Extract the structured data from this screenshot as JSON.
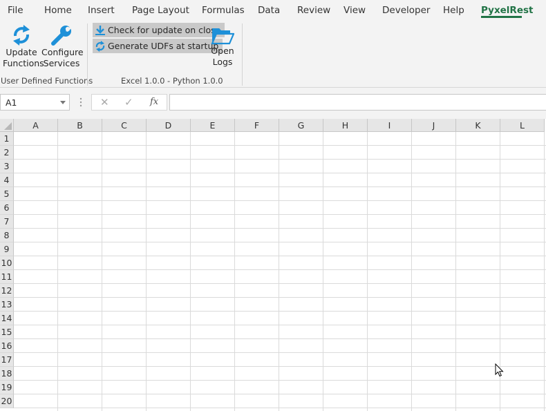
{
  "tabs": [
    "File",
    "Home",
    "Insert",
    "Page Layout",
    "Formulas",
    "Data",
    "Review",
    "View",
    "Developer",
    "Help",
    "PyxelRest"
  ],
  "active_tab": "PyxelRest",
  "ribbon": {
    "update_functions": {
      "line1": "Update",
      "line2": "Functions",
      "icon": "refresh-arrows-icon"
    },
    "configure_services": {
      "line1": "Configure",
      "line2": "Services",
      "icon": "wrench-icon"
    },
    "group1_label": "User Defined Functions",
    "check_update": {
      "label": "Check for update on close",
      "icon": "download-arrow-icon"
    },
    "generate_udfs": {
      "label": "Generate UDFs at startup",
      "icon": "refresh-arrows-icon"
    },
    "open_logs": {
      "line1": "Open",
      "line2": "Logs",
      "icon": "folder-open-icon"
    },
    "group2_label": "Excel 1.0.0 - Python 1.0.0"
  },
  "formula_bar": {
    "name_box": "A1",
    "cancel_symbol": "✕",
    "enter_symbol": "✓",
    "fx_symbol": "fx",
    "formula": ""
  },
  "grid": {
    "columns": [
      "A",
      "B",
      "C",
      "D",
      "E",
      "F",
      "G",
      "H",
      "I",
      "J",
      "K",
      "L"
    ],
    "rows": [
      "1",
      "2",
      "3",
      "4",
      "5",
      "6",
      "7",
      "8",
      "9",
      "10",
      "11",
      "12",
      "13",
      "14",
      "15",
      "16",
      "17",
      "18",
      "19",
      "20"
    ]
  },
  "colors": {
    "accent": "#217346",
    "icon_blue": "#1e90d8",
    "ribbon_bg": "#f3f3f3"
  }
}
